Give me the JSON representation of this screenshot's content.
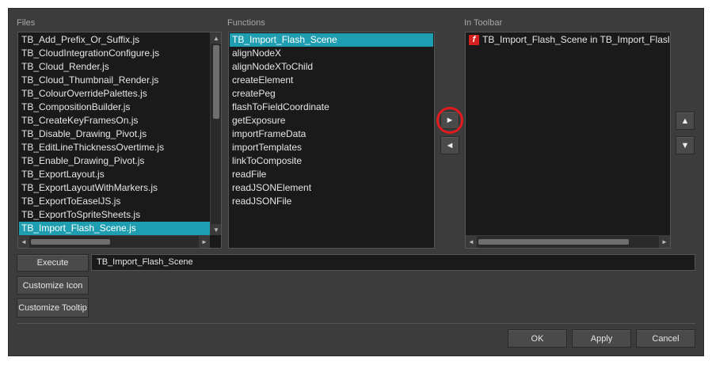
{
  "labels": {
    "files": "Files",
    "functions": "Functions",
    "in_toolbar": "In Toolbar"
  },
  "files": [
    "TB_Add_Prefix_Or_Suffix.js",
    "TB_CloudIntegrationConfigure.js",
    "TB_Cloud_Render.js",
    "TB_Cloud_Thumbnail_Render.js",
    "TB_ColourOverridePalettes.js",
    "TB_CompositionBuilder.js",
    "TB_CreateKeyFramesOn.js",
    "TB_Disable_Drawing_Pivot.js",
    "TB_EditLineThicknessOvertime.js",
    "TB_Enable_Drawing_Pivot.js",
    "TB_ExportLayout.js",
    "TB_ExportLayoutWithMarkers.js",
    "TB_ExportToEaselJS.js",
    "TB_ExportToSpriteSheets.js",
    "TB_Import_Flash_Scene.js"
  ],
  "functions": [
    "TB_Import_Flash_Scene",
    "alignNodeX",
    "alignNodeXToChild",
    "createElement",
    "createPeg",
    "flashToFieldCoordinate",
    "getExposure",
    "importFrameData",
    "importTemplates",
    "linkToComposite",
    "readFile",
    "readJSONElement",
    "readJSONFile"
  ],
  "toolbar_items": [
    "TB_Import_Flash_Scene in TB_Import_Flash_Scene.js"
  ],
  "icons": {
    "add": "►",
    "remove": "◄",
    "move_up": "▲",
    "move_down": "▼",
    "flash": "f",
    "scroll_left": "◄",
    "scroll_right": "►",
    "scroll_up": "▲",
    "scroll_down": "▼"
  },
  "buttons": {
    "execute": "Execute",
    "customize_icon": "Customize Icon",
    "customize_tooltip": "Customize Tooltip",
    "ok": "OK",
    "apply": "Apply",
    "cancel": "Cancel"
  },
  "execute_field_value": "TB_Import_Flash_Scene",
  "selection": {
    "file_index": 14,
    "function_index": 0
  },
  "colors": {
    "selection": "#1e9eb0",
    "highlight_ring": "#e01b1b",
    "flash_icon": "#d62020"
  }
}
